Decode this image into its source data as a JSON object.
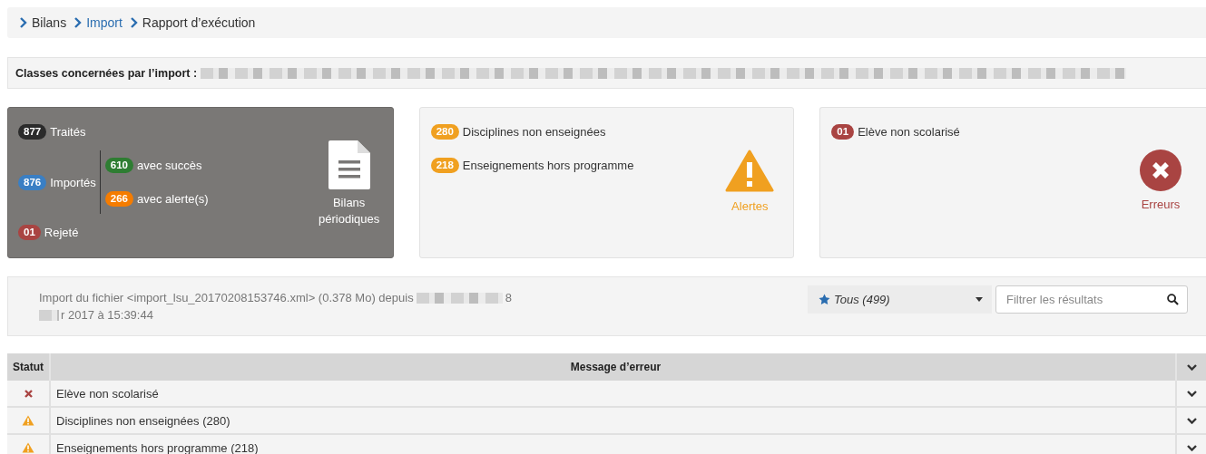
{
  "breadcrumb": [
    {
      "label": "Bilans",
      "kind": "text"
    },
    {
      "label": "Import",
      "kind": "link"
    },
    {
      "label": "Rapport d’exécution",
      "kind": "text"
    }
  ],
  "classes_bar": {
    "label": "Classes concernées par l’import :"
  },
  "summary": {
    "treated": {
      "count": "877",
      "label": "Traités",
      "color": "#2b2b2b"
    },
    "imported": {
      "count": "876",
      "label": "Importés",
      "color": "#3a7fc4"
    },
    "breakdown": [
      {
        "count": "610",
        "label": "avec succès",
        "color": "#2e7d32"
      },
      {
        "count": "266",
        "label": "avec alerte(s)",
        "color": "#f57c00"
      }
    ],
    "rejected": {
      "count": "01",
      "label": "Rejeté",
      "color": "#a94442"
    },
    "caption": "Bilans périodiques"
  },
  "alerts": {
    "items": [
      {
        "count": "280",
        "label": "Disciplines non enseignées",
        "color": "#f0a020"
      },
      {
        "count": "218",
        "label": "Enseignements hors programme",
        "color": "#f0a020"
      }
    ],
    "caption": "Alertes"
  },
  "errors": {
    "items": [
      {
        "count": "01",
        "label": "Elève non scolarisé",
        "color": "#a94442"
      }
    ],
    "caption": "Erreurs"
  },
  "import_info": {
    "text": "Import du fichier <import_lsu_20170208153746.xml> (0.378 Mo) depuis",
    "tail": "8",
    "line2": "r 2017 à 15:39:44"
  },
  "filter": {
    "value": "Tous (499)"
  },
  "search": {
    "placeholder": "Filtrer les résultats"
  },
  "table": {
    "columns": [
      "Statut",
      "Message d’erreur"
    ],
    "rows": [
      {
        "kind": "error",
        "message": "Elève non scolarisé"
      },
      {
        "kind": "warning",
        "message": "Disciplines non enseignées (280)"
      },
      {
        "kind": "warning",
        "message": "Enseignements hors programme (218)"
      }
    ]
  }
}
